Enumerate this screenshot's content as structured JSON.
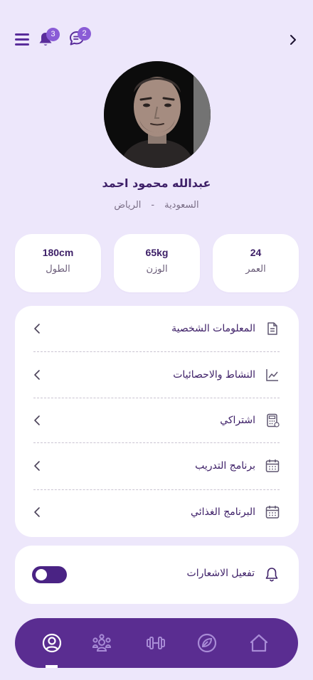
{
  "header": {
    "notifications_count": "3",
    "messages_count": "2",
    "icons": [
      "menu-icon",
      "bell-icon",
      "chat-icon",
      "chevron-right-icon"
    ]
  },
  "profile": {
    "name": "عبدالله محمود احمد",
    "country": "السعودية",
    "separator": "-",
    "city": "الرياض"
  },
  "stats": [
    {
      "value": "24",
      "label": "العمر"
    },
    {
      "value": "65kg",
      "label": "الوزن"
    },
    {
      "value": "180cm",
      "label": "الطول"
    }
  ],
  "menu": [
    {
      "label": "المعلومات الشخصية",
      "icon": "document-icon"
    },
    {
      "label": "النشاط والاحصائيات",
      "icon": "chart-icon"
    },
    {
      "label": "اشتراكي",
      "icon": "calculator-icon"
    },
    {
      "label": "برنامج التدريب",
      "icon": "calendar-icon"
    },
    {
      "label": "البرنامج الغذائي",
      "icon": "calendar-icon"
    }
  ],
  "notifications": {
    "label": "تفعيل الاشعارات",
    "enabled": true
  },
  "bottom_nav": {
    "items": [
      "profile-icon",
      "community-icon",
      "dumbbell-icon",
      "discover-icon",
      "home-icon"
    ],
    "active": "profile-icon"
  },
  "colors": {
    "background": "#ede7fb",
    "primary": "#5a2d91",
    "badge": "#8a5cd6",
    "text": "#3e2068"
  }
}
